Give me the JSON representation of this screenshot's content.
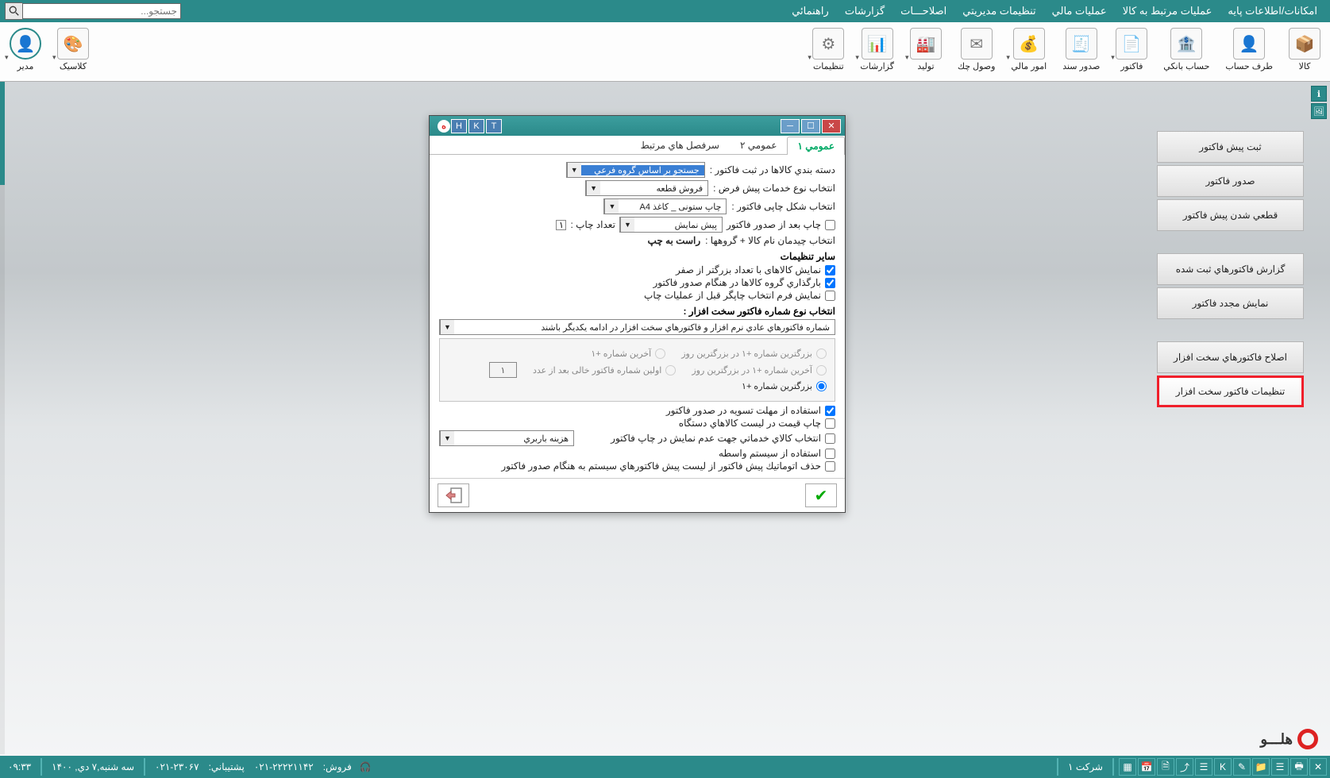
{
  "menu": {
    "items": [
      "امکانات/اطلاعات پایه",
      "عملیات مرتبط به کالا",
      "عملیات مالي",
      "تنظیمات مدیریتي",
      "اصلاحـــات",
      "گزارشات",
      "راهنمائي"
    ],
    "search_placeholder": "جستجو..."
  },
  "ribbon": {
    "items": [
      {
        "label": "کالا",
        "icon": "📦"
      },
      {
        "label": "طرف حساب",
        "icon": "👤"
      },
      {
        "label": "حساب بانکي",
        "icon": "🏦"
      },
      {
        "label": "فاکتور",
        "icon": "📄"
      },
      {
        "label": "صدور سند",
        "icon": "🧾"
      },
      {
        "label": "امور مالي",
        "icon": "💰"
      },
      {
        "label": "وصول چك",
        "icon": "✉"
      },
      {
        "label": "تولید",
        "icon": "🏭"
      },
      {
        "label": "گزارشات",
        "icon": "📊"
      },
      {
        "label": "تنظیمات",
        "icon": "⚙"
      }
    ],
    "right": [
      {
        "label": "کلاسیک",
        "icon": "🎨"
      },
      {
        "label": "مدیر",
        "icon": "👤"
      }
    ]
  },
  "side_buttons": {
    "g1": [
      "ثبت پیش فاکتور",
      "صدور فاکتور",
      "قطعي شدن پیش فاکتور"
    ],
    "g2": [
      "گزارش فاکتورهاي ثبت شده",
      "نمایش مجدد فاکتور"
    ],
    "g3": [
      "اصلاح فاکتورهاي سخت افزار",
      "تنظیمات فاکتور سخت افزار"
    ]
  },
  "dialog": {
    "title_letters": [
      "T",
      "K",
      "H"
    ],
    "tabs": [
      "عمومي ۱",
      "عمومي ۲",
      "سرفصل هاي مرتبط"
    ],
    "r1_lbl": "دسته بندي کالاها در ثبت فاکتور :",
    "r1_val": "جستجو بر اساس گروه فرعي",
    "r2_lbl": "انتخاب نوع خدمات پیش فرض :",
    "r2_val": "فروش قطعه",
    "r3_lbl": "انتخاب شکل چاپی فاکتور :",
    "r3_val": "چاپ ستونی _ کاغذ A4",
    "r4_lbl": "چاپ بعد از صدور فاکتور",
    "r4_val": "پیش نمایش",
    "r4b_lbl": "تعداد چاپ :",
    "r4b_val": "۱",
    "r5_lbl": "انتخاب چیدمان نام کالا + گروهها :",
    "r5_val": "راست به چپ",
    "hdr1": "سایر تنظیمات",
    "c1": "نمایش کالاهای با تعداد بزرگتر از صفر",
    "c2": "بارگذاري گروه کالاها در هنگام صدور فاکتور",
    "c3": "نمایش فرم انتخاب چاپگر قبل از عملیات چاپ",
    "hdr2": "انتخاب نوع شماره فاکتور سخت افزار :",
    "sel_full": "شماره فاکتورهاي عادي نرم افزار و فاکتورهاي سخت افزار در ادامه یکدیگر باشند",
    "rad1": "بزرگترین شماره +۱ در بزرگترین روز",
    "rad1b": "آخرین شماره +۱",
    "rad2": "آخرین شماره +۱ در بزرگترین روز",
    "rad2b": "اولین شماره فاکتور خالی بعد از عدد",
    "rad2b_val": "۱",
    "rad3": "بزرگترین شماره +۱",
    "c4": "استفاده از مهلت تسویه در صدور فاکتور",
    "c5": "چاپ قیمت در لیست کالاهاي دستگاه",
    "c6": "انتخاب کالاي خدماتي جهت عدم نمایش در چاپ فاکتور",
    "c6_val": "هزینه باربري",
    "c7": "استفاده از سیستم واسطه",
    "c8": "حذف اتوماتیك پیش فاکتور از لیست پیش فاکتورهاي سیستم به هنگام صدور فاکتور"
  },
  "statusbar": {
    "company": "شرکت ۱",
    "date": "سه شنبه,۷ دي, ۱۴۰۰",
    "time": "۰۹:۳۳",
    "sales_lbl": "فروش:",
    "sales_no": "۰۲۱-۲۲۲۲۱۱۴۲",
    "support_lbl": "پشتیباني:",
    "support_no": "۰۲۱-۲۳۰۶۷"
  },
  "brand": "هلـــو"
}
